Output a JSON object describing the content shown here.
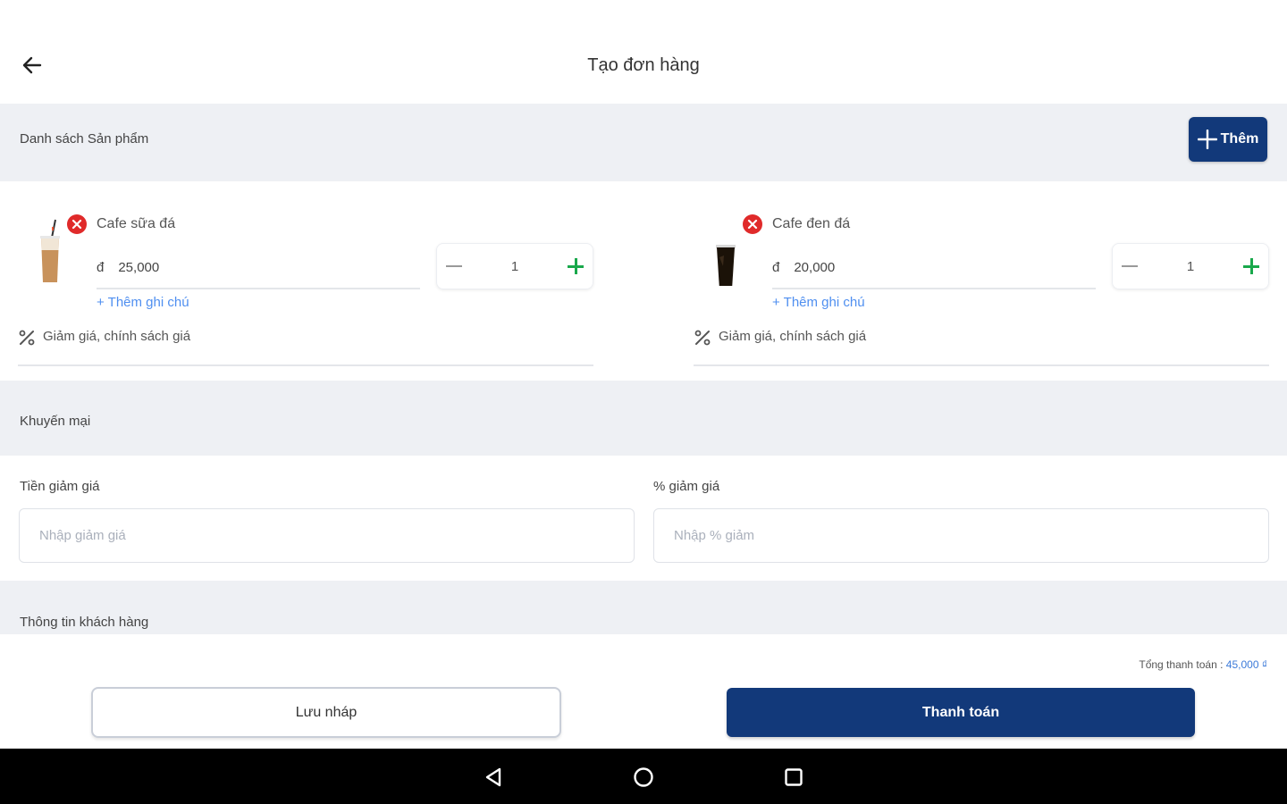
{
  "header": {
    "title": "Tạo đơn hàng",
    "back_icon": "arrow-left-icon"
  },
  "products_section": {
    "label": "Danh sách Sản phẩm",
    "add_label": "Thêm",
    "items": [
      {
        "name": "Cafe sữa đá",
        "currency": "đ",
        "price": "25,000",
        "qty": "1",
        "note_label": "+ Thêm ghi chú",
        "discount_label": "Giảm giá, chính sách giá"
      },
      {
        "name": "Cafe đen đá",
        "currency": "đ",
        "price": "20,000",
        "qty": "1",
        "note_label": "+ Thêm ghi chú",
        "discount_label": "Giảm giá, chính sách giá"
      }
    ]
  },
  "promotion": {
    "label": "Khuyến mại",
    "amount_label": "Tiền giảm giá",
    "amount_placeholder": "Nhập giảm giá",
    "percent_label": "% giảm giá",
    "percent_placeholder": "Nhập % giảm"
  },
  "customer": {
    "label": "Thông tin khách hàng"
  },
  "footer": {
    "total_label": "Tổng thanh toán :",
    "total_value": "45,000 ₫",
    "draft_label": "Lưu nháp",
    "pay_label": "Thanh toán"
  },
  "colors": {
    "primary": "#12397a",
    "accent_green": "#19a84b",
    "danger": "#e02a2a",
    "link": "#4f8ff0",
    "band": "#eef0f4"
  }
}
